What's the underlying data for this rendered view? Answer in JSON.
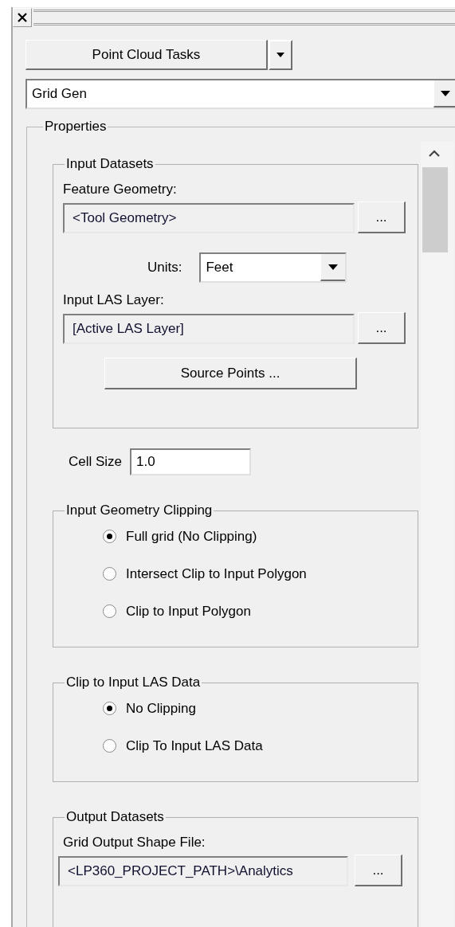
{
  "task_menu": {
    "label": "Point Cloud Tasks"
  },
  "tool_select": {
    "value": "Grid Gen"
  },
  "properties": {
    "title": "Properties",
    "input_datasets": {
      "title": "Input Datasets",
      "feature_geometry": {
        "label": "Feature Geometry:",
        "value": "<Tool Geometry>",
        "browse": "..."
      },
      "units": {
        "label": "Units:",
        "value": "Feet"
      },
      "input_las_layer": {
        "label": "Input LAS Layer:",
        "value": "[Active LAS Layer]",
        "browse": "..."
      },
      "source_points_button": "Source Points ..."
    },
    "cell_size": {
      "label": "Cell Size",
      "value": "1.0"
    },
    "radio_groups": [
      {
        "title": "Input Geometry Clipping",
        "options": [
          {
            "label": "Full grid (No Clipping)",
            "selected": true
          },
          {
            "label": "Intersect Clip to Input Polygon",
            "selected": false
          },
          {
            "label": "Clip to Input Polygon",
            "selected": false
          }
        ]
      },
      {
        "title": "Clip to Input LAS Data",
        "options": [
          {
            "label": "No Clipping",
            "selected": true
          },
          {
            "label": "Clip To Input LAS Data",
            "selected": false
          }
        ]
      }
    ],
    "output_datasets": {
      "title": "Output Datasets",
      "grid_output_shape_file": {
        "label": "Grid Output Shape File:",
        "value": "<LP360_PROJECT_PATH>\\Analytics",
        "browse": "..."
      }
    }
  }
}
